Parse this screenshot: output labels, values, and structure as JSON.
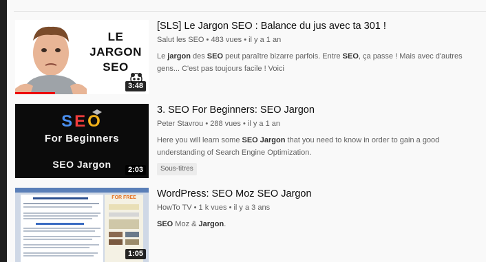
{
  "results": [
    {
      "title": "[SLS] Le Jargon SEO : Balance du jus avec ta 301 !",
      "channel": "Salut les SEO",
      "views": "483 vues",
      "age": "il y a 1 an",
      "duration": "3:48",
      "watch_progress": 0.3,
      "thumb_text": "LE JARGON SEO",
      "desc": [
        {
          "t": "Le ",
          "b": false
        },
        {
          "t": "jargon",
          "b": true
        },
        {
          "t": " des ",
          "b": false
        },
        {
          "t": "SEO",
          "b": true
        },
        {
          "t": " peut paraître bizarre parfois. Entre ",
          "b": false
        },
        {
          "t": "SEO",
          "b": true
        },
        {
          "t": ", ça passe ! Mais avec d'autres gens... C'est pas toujours facile ! Voici",
          "b": false
        }
      ]
    },
    {
      "title": "3. SEO For Beginners: SEO Jargon",
      "channel": "Peter Stavrou",
      "views": "288 vues",
      "age": "il y a 1 an",
      "duration": "2:03",
      "badge": "Sous-titres",
      "thumb_seo": "SEO",
      "thumb_line1": "For Beginners",
      "thumb_line2": "SEO Jargon",
      "desc": [
        {
          "t": "Here you will learn some ",
          "b": false
        },
        {
          "t": "SEO Jargon",
          "b": true
        },
        {
          "t": " that you need to know in order to gain a good understanding of Search Engine Optimization.",
          "b": false
        }
      ]
    },
    {
      "title": "WordPress: SEO Moz SEO Jargon",
      "channel": "HowTo TV",
      "views": "1 k vues",
      "age": "il y a 3 ans",
      "duration": "1:05",
      "thumb_sidebar": "FOR FREE",
      "desc": [
        {
          "t": "SEO",
          "b": true
        },
        {
          "t": " Moz & ",
          "b": false
        },
        {
          "t": "Jargon",
          "b": true
        },
        {
          "t": ".",
          "b": false
        }
      ]
    }
  ],
  "colors": {
    "seo_s": "#4a8ff0",
    "seo_e": "#f03c3c",
    "seo_o": "#f3b21a",
    "progress": "#ee0000"
  }
}
